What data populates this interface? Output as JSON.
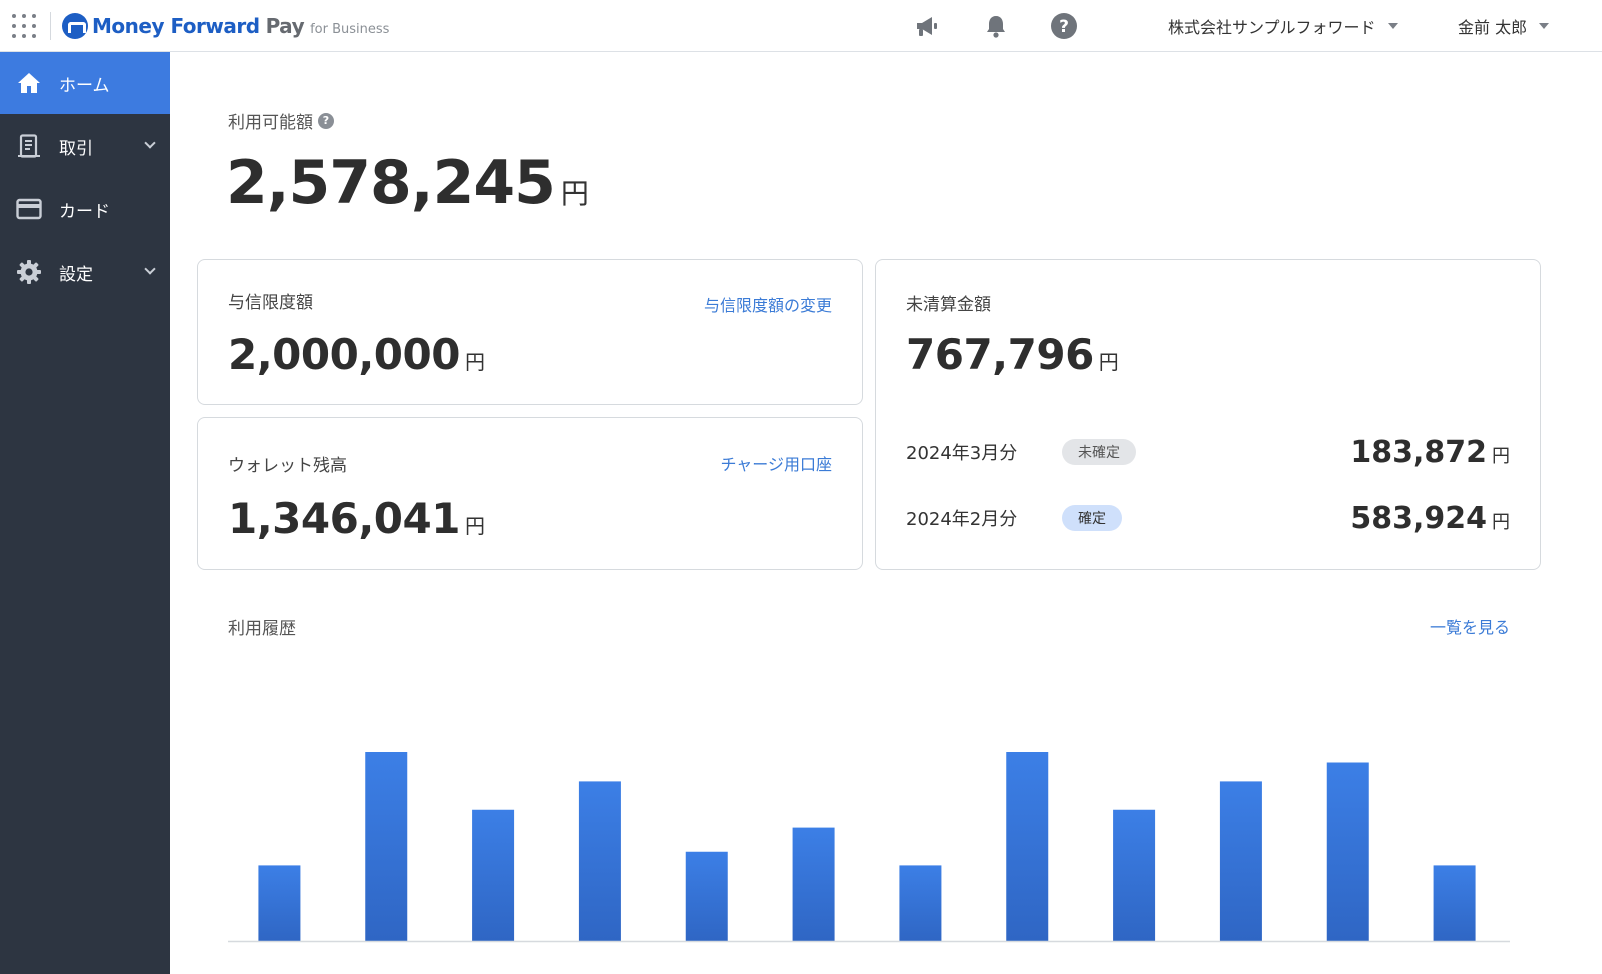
{
  "header": {
    "brand_name": "Money Forward",
    "brand_pay": "Pay",
    "brand_sub": "for Business",
    "icons": [
      "apps-grid-icon",
      "megaphone-icon",
      "bell-icon",
      "help-icon"
    ],
    "company": "株式会社サンプルフォワード",
    "user": "金前 太郎"
  },
  "sidebar": {
    "items": [
      {
        "label": "ホーム",
        "icon": "home-icon",
        "active": true
      },
      {
        "label": "取引",
        "icon": "receipt-icon",
        "expandable": true
      },
      {
        "label": "カード",
        "icon": "card-icon"
      },
      {
        "label": "設定",
        "icon": "gear-icon",
        "expandable": true
      }
    ]
  },
  "available": {
    "label": "利用可能額",
    "amount": "2,578,245",
    "unit": "円"
  },
  "credit_limit": {
    "title": "与信限度額",
    "link": "与信限度額の変更",
    "amount": "2,000,000",
    "unit": "円"
  },
  "wallet": {
    "title": "ウォレット残高",
    "link": "チャージ用口座",
    "amount": "1,346,041",
    "unit": "円"
  },
  "unsettled": {
    "title": "未清算金額",
    "amount": "767,796",
    "unit": "円",
    "rows": [
      {
        "month": "2024年3月分",
        "status": "未確定",
        "amount": "183,872",
        "unit": "円"
      },
      {
        "month": "2024年2月分",
        "status": "確定",
        "amount": "583,924",
        "unit": "円"
      }
    ]
  },
  "history": {
    "title": "利用履歴",
    "link": "一覧を見る"
  },
  "colors": {
    "accent": "#3d7be0",
    "sidebar_bg": "#2d3541",
    "link": "#3b7bd6",
    "bar": "#3a78dc"
  },
  "chart_data": {
    "type": "bar",
    "values": [
      72,
      180,
      125,
      152,
      85,
      108,
      72,
      180,
      125,
      152,
      170,
      72
    ],
    "ylim": [
      0,
      200
    ],
    "grid": false
  }
}
